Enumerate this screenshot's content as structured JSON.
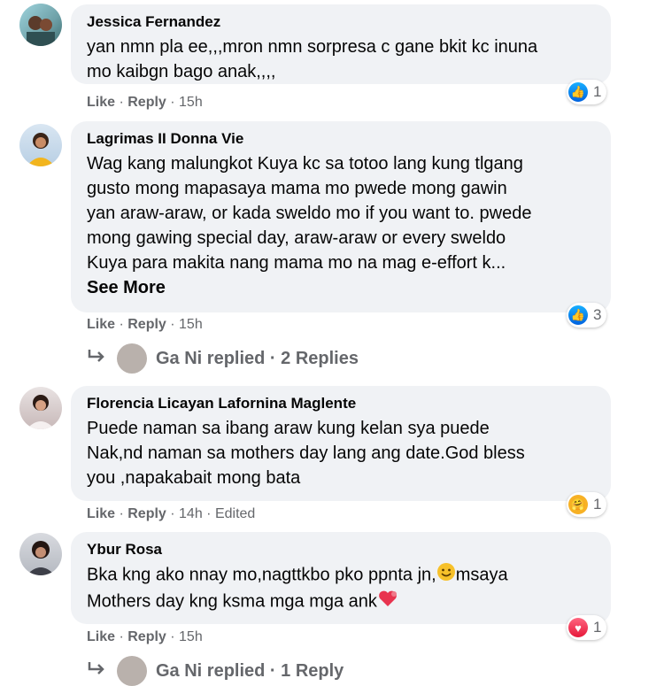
{
  "comments": [
    {
      "author": "Jessica Fernandez",
      "text": "yan nmn pla ee,,,mron nmn sorpresa c gane bkit kc inuna\nmo kaibgn bago anak,,,,",
      "like_label": "Like",
      "reply_label": "Reply",
      "time": "15h",
      "reaction_count": "1",
      "reaction_type": "like-icon"
    },
    {
      "author": "Lagrimas II Donna Vie",
      "text": "Wag kang malungkot Kuya kc sa totoo lang kung tlgang\ngusto mong mapasaya mama mo pwede mong gawin\nyan araw-araw, or kada sweldo mo if you want to. pwede\nmong gawing special day, araw-araw or every sweldo\nKuya para makita nang mama mo na mag e-effort k...",
      "see_more": "See More",
      "like_label": "Like",
      "reply_label": "Reply",
      "time": "15h",
      "reaction_count": "3",
      "reaction_type": "like-icon",
      "replies": "Ga Ni replied · 2 Replies"
    },
    {
      "author": "Florencia Licayan Lafornina Maglente",
      "text": "Puede naman sa ibang araw kung kelan sya puede\nNak,nd naman sa mothers day lang ang date.God bless\nyou ,napakabait mong bata",
      "like_label": "Like",
      "reply_label": "Reply",
      "time": "14h",
      "edited": "Edited",
      "reaction_count": "1",
      "reaction_type": "care-icon"
    },
    {
      "author": "Ybur Rosa",
      "text_part1": "Bka kng ako nnay mo,nagttkbo pko ppnta jn,",
      "text_part2": "msaya",
      "text_line2": "Mothers day kng ksma mga mga ank",
      "like_label": "Like",
      "reply_label": "Reply",
      "time": "15h",
      "reaction_count": "1",
      "reaction_type": "love-icon",
      "replies": "Ga Ni replied · 1 Reply"
    }
  ],
  "separator": " · ",
  "colors": {
    "bubble": "#f0f2f5",
    "meta": "#65676b",
    "like": "#0866ff",
    "love": "#f33e58"
  }
}
